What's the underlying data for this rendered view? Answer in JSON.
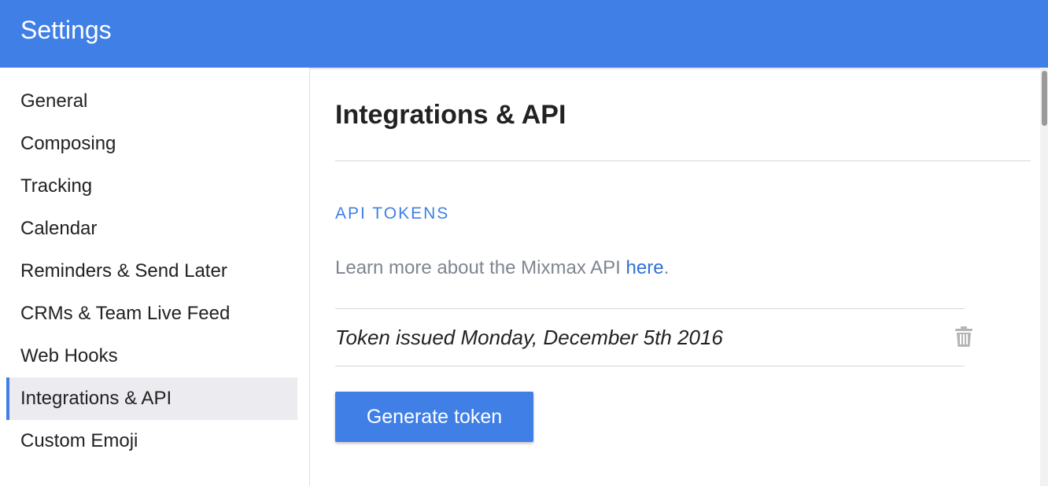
{
  "header": {
    "title": "Settings"
  },
  "sidebar": {
    "items": [
      {
        "label": "General"
      },
      {
        "label": "Composing"
      },
      {
        "label": "Tracking"
      },
      {
        "label": "Calendar"
      },
      {
        "label": "Reminders & Send Later"
      },
      {
        "label": "CRMs & Team Live Feed"
      },
      {
        "label": "Web Hooks"
      },
      {
        "label": "Integrations & API",
        "active": true
      },
      {
        "label": "Custom Emoji"
      }
    ]
  },
  "main": {
    "title": "Integrations & API",
    "section_title": "API TOKENS",
    "learn_prefix": "Learn more about the Mixmax API ",
    "learn_link": "here",
    "learn_suffix": ".",
    "token_text": "Token issued Monday, December 5th 2016",
    "generate_button": "Generate token",
    "delete_icon": "trash-icon"
  },
  "colors": {
    "accent": "#3f7fe6",
    "link": "#2f6fd6",
    "muted_text": "#7f8590"
  }
}
